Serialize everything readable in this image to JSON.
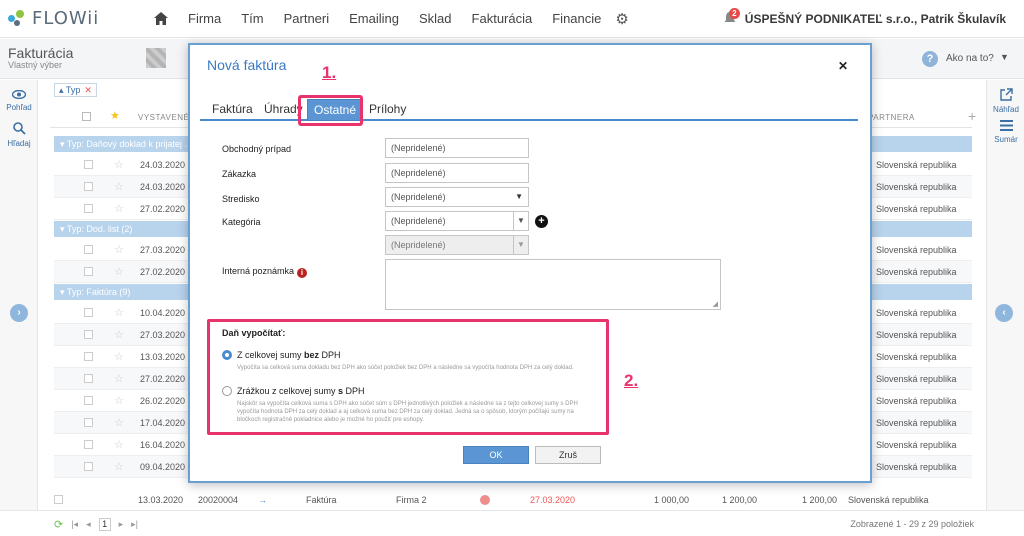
{
  "app": {
    "logo": "FLOWii"
  },
  "nav": {
    "items": [
      "Firma",
      "Tím",
      "Partneri",
      "Emailing",
      "Sklad",
      "Fakturácia",
      "Financie"
    ],
    "notification_count": "2",
    "company": "ÚSPEŠNÝ PODNIKATEĽ s.r.o., Patrik Škulavík"
  },
  "page": {
    "title": "Fakturácia",
    "subtitle": "Vlastný výber",
    "help_label": "Ako na to?"
  },
  "rails": {
    "left": [
      "Pohľad",
      "Hľadaj"
    ],
    "right": [
      "Náhľad",
      "Sumár"
    ]
  },
  "table": {
    "filter_chip": "Typ",
    "header_issued": "VYSTAVENÉ",
    "header_partner": "PARTNERA",
    "groups": [
      {
        "label": "Typ: Daňový doklad k prijatej …",
        "rows": [
          {
            "date": "24.03.2020",
            "country": "Slovenská republika"
          },
          {
            "date": "24.03.2020",
            "country": "Slovenská republika"
          },
          {
            "date": "27.02.2020",
            "country": "Slovenská republika"
          }
        ]
      },
      {
        "label": "Typ: Dod. list (2)",
        "rows": [
          {
            "date": "27.03.2020",
            "country": "Slovenská republika"
          },
          {
            "date": "27.02.2020",
            "country": "Slovenská republika"
          }
        ]
      },
      {
        "label": "Typ: Faktúra (9)",
        "rows": [
          {
            "date": "10.04.2020",
            "country": "Slovenská republika"
          },
          {
            "date": "27.03.2020",
            "country": "Slovenská republika"
          },
          {
            "date": "13.03.2020",
            "country": "Slovenská republika"
          },
          {
            "date": "27.02.2020",
            "country": "Slovenská republika"
          },
          {
            "date": "26.02.2020",
            "country": "Slovenská republika"
          },
          {
            "date": "17.04.2020",
            "country": "Slovenská republika"
          },
          {
            "date": "16.04.2020",
            "country": "Slovenská republika"
          },
          {
            "date": "09.04.2020",
            "country": "Slovenská republika"
          }
        ]
      }
    ],
    "last_row": {
      "date": "13.03.2020",
      "number": "20020004",
      "type": "Faktúra",
      "company": "Firma 2",
      "due": "27.03.2020",
      "amount1": "1 000,00",
      "amount2": "1 200,00",
      "amount3": "1 200,00",
      "country": "Slovenská republika"
    }
  },
  "footer": {
    "page": "1",
    "shown": "Zobrazené 1 - 29 z 29 položiek"
  },
  "modal": {
    "title": "Nová faktúra",
    "tabs": [
      "Faktúra",
      "Úhrady",
      "Ostatné",
      "Prílohy"
    ],
    "active_tab": "Ostatné",
    "fields": [
      {
        "label": "Obchodný prípad",
        "value": "(Nepridelené)"
      },
      {
        "label": "Zákazka",
        "value": "(Nepridelené)"
      },
      {
        "label": "Stredisko",
        "value": "(Nepridelené)"
      },
      {
        "label": "Kategória",
        "value": "(Nepridelené)"
      },
      {
        "label": "",
        "value": "(Nepridelené)"
      }
    ],
    "note_label": "Interná poznámka",
    "tax": {
      "title": "Daň vypočítať:",
      "opt1_pre": "Z celkovej sumy ",
      "opt1_bold": "bez",
      "opt1_post": " DPH",
      "opt1_desc": "Vypočíta sa celková suma dokladu bez DPH ako súčet položiek bez DPH a následne sa vypočíta hodnota DPH za celý doklad.",
      "opt2_pre": "Zrážkou z celkovej sumy ",
      "opt2_bold": "s",
      "opt2_post": " DPH",
      "opt2_desc": "Najskôr sa vypočíta celková suma s DPH ako súčet súm s DPH jednotlivých položiek a následne sa z tejto celkovej sumy s DPH vypočíta hodnota DPH za celý doklad a aj celková suma bez DPH za celý doklad. Jedná sa o spôsob, ktorým počítajú sumy na bločkoch registračné pokladnice alebo je možné ho použiť pre eshopy."
    },
    "ok": "OK",
    "cancel": "Zruš"
  },
  "annotations": {
    "one": "1.",
    "two": "2."
  },
  "colors": {
    "accent": "#5b95d3",
    "highlight": "#e8336d",
    "group": "#b8d3ec"
  }
}
